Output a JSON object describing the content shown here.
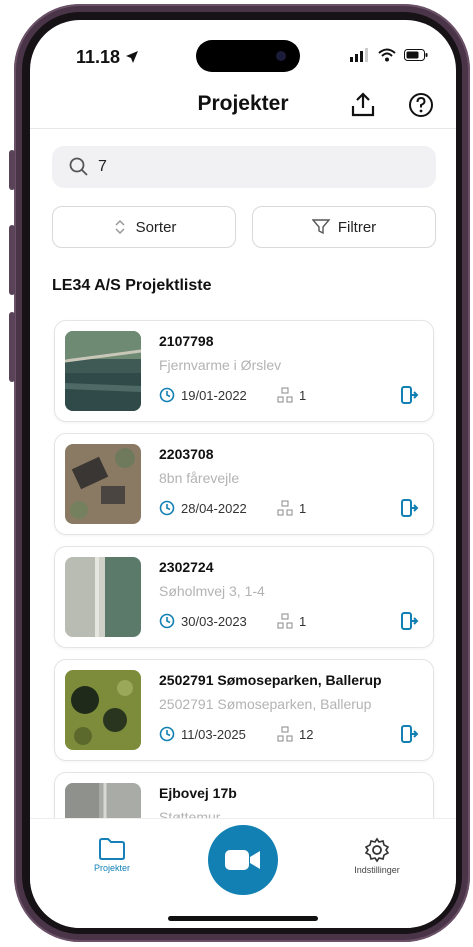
{
  "status": {
    "time": "11.18"
  },
  "header": {
    "title": "Projekter"
  },
  "search": {
    "value": "7"
  },
  "controls": {
    "sort_label": "Sorter",
    "filter_label": "Filtrer"
  },
  "list": {
    "title": "LE34 A/S Projektliste",
    "items": [
      {
        "id": "2107798",
        "subtitle": "Fjernvarme i Ørslev",
        "date": "19/01-2022",
        "count": "1"
      },
      {
        "id": "2203708",
        "subtitle": "8bn fårevejle",
        "date": "28/04-2022",
        "count": "1"
      },
      {
        "id": "2302724",
        "subtitle": "Søholmvej 3, 1-4",
        "date": "30/03-2023",
        "count": "1"
      },
      {
        "id": "2502791 Sømoseparken, Ballerup",
        "subtitle": "2502791 Sømoseparken, Ballerup",
        "date": "11/03-2025",
        "count": "12"
      },
      {
        "id": "Ejbovej 17b",
        "subtitle": "Støttemur",
        "date": "",
        "count": ""
      }
    ]
  },
  "tabbar": {
    "projects_label": "Projekter",
    "settings_label": "Indstillinger"
  },
  "colors": {
    "accent": "#1380b3",
    "text": "#111111",
    "muted": "#b3b3b3",
    "frame": "#4a3548"
  },
  "icons": {
    "upload": "upload-icon",
    "help": "help-icon",
    "search": "search-icon",
    "sort": "sort-icon",
    "filter": "filter-icon",
    "clock": "clock-icon",
    "layers": "layers-icon",
    "exit": "exit-icon",
    "folder": "folder-icon",
    "camera": "video-camera-icon",
    "gear": "gear-icon"
  }
}
